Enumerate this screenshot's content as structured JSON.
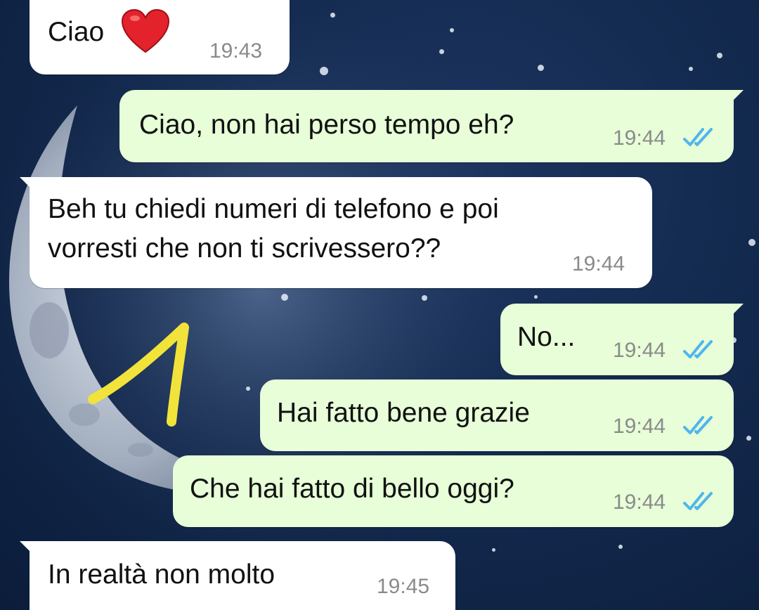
{
  "chat": {
    "messages": [
      {
        "direction": "incoming",
        "text": "Ciao",
        "emoji": "red-heart",
        "time": "19:43"
      },
      {
        "direction": "outgoing",
        "text": "Ciao, non hai perso tempo eh?",
        "time": "19:44",
        "status": "read"
      },
      {
        "direction": "incoming",
        "text": "Beh tu chiedi numeri di telefono e poi\nvorresti che non ti scrivessero??",
        "time": "19:44"
      },
      {
        "direction": "outgoing",
        "text": "No...",
        "time": "19:44",
        "status": "read"
      },
      {
        "direction": "outgoing",
        "text": "Hai fatto bene grazie",
        "time": "19:44",
        "status": "read"
      },
      {
        "direction": "outgoing",
        "text": "Che hai fatto di bello oggi?",
        "time": "19:44",
        "status": "read"
      },
      {
        "direction": "incoming",
        "text": "In realtà non molto",
        "time": "19:45"
      }
    ]
  },
  "colors": {
    "incoming_bubble": "#ffffff",
    "outgoing_bubble": "#e7fed8",
    "read_ticks": "#4fb6ec",
    "annotation": "#f2e33b",
    "wallpaper": "#132a4f"
  },
  "icons": {
    "read_receipt": "double-check-icon",
    "annotation_mark": "yellow-number-one-scribble"
  }
}
